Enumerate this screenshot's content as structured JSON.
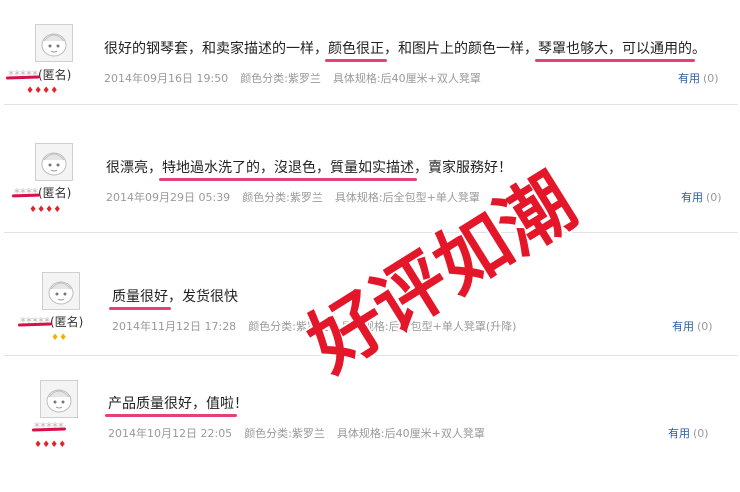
{
  "reviews": [
    {
      "username": "**** (匿名)",
      "username_hidden": "*****",
      "username_suffix": "(匿名)",
      "badge_color": "red",
      "badges": "♦♦♦♦",
      "content": [
        {
          "t": "很好的钢琴套，和卖家描述的一样，",
          "hl": false
        },
        {
          "t": "颜色很正",
          "hl": true
        },
        {
          "t": "，和图片上的颜色一样，",
          "hl": false
        },
        {
          "t": "琴罩也够大，可以通用的",
          "hl": true
        },
        {
          "t": "。",
          "hl": false
        }
      ],
      "date": "2014年09月16日 19:50",
      "color_spec": "颜色分类:紫罗兰",
      "size_spec": "具体规格:后40厘米+双人凳罩",
      "useful_label": "有用",
      "useful_count": "(0)"
    },
    {
      "username": "**** (匿名)",
      "username_hidden": "****",
      "username_suffix": "(匿名)",
      "badge_color": "red",
      "badges": "♦♦♦♦",
      "content": [
        {
          "t": "很漂亮，",
          "hl": false
        },
        {
          "t": "特地過水洗了的，",
          "hl": true
        },
        {
          "t": "沒退色，",
          "hl": true
        },
        {
          "t": "質量如实描述",
          "hl": true
        },
        {
          "t": "，賣家服務好！",
          "hl": false
        }
      ],
      "date": "2014年09月29日 05:39",
      "color_spec": "颜色分类:紫罗兰",
      "size_spec": "具体规格:后全包型+单人凳罩",
      "useful_label": "有用",
      "useful_count": "(0)"
    },
    {
      "username": "**** (匿名)",
      "username_hidden": "*****",
      "username_suffix": "(匿名)",
      "badge_color": "gold",
      "badges": "♦♦",
      "content": [
        {
          "t": "质量很好",
          "hl": true
        },
        {
          "t": "，发货很快",
          "hl": false
        }
      ],
      "date": "2014年11月12日 17:28",
      "color_spec": "颜色分类:紫罗兰",
      "size_spec": "具体规格:后全包型+单人凳罩(升降)",
      "useful_label": "有用",
      "useful_count": "(0)"
    },
    {
      "username": "****",
      "username_hidden": "*****",
      "username_suffix": "",
      "badge_color": "red",
      "badges": "♦♦♦♦",
      "content": [
        {
          "t": "产品质量很好，值啦",
          "hl": true
        },
        {
          "t": "！",
          "hl": false
        }
      ],
      "date": "2014年10月12日 22:05",
      "color_spec": "颜色分类:紫罗兰",
      "size_spec": "具体规格:后40厘米+双人凳罩",
      "useful_label": "有用",
      "useful_count": "(0)"
    }
  ],
  "stamp_text": "好评如潮",
  "colors": {
    "stamp": "#e4162a",
    "highlight": "#e4417a",
    "link": "#2a5ea8"
  }
}
